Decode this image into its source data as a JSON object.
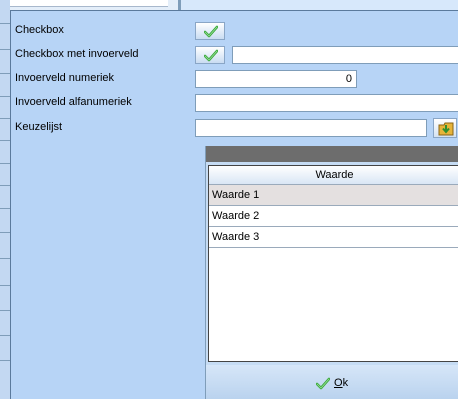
{
  "form": {
    "rows": [
      {
        "label": "Checkbox",
        "checked": true
      },
      {
        "label": "Checkbox met invoerveld",
        "checked": true,
        "value": ""
      },
      {
        "label": "Invoerveld numeriek",
        "value": "0"
      },
      {
        "label": "Invoerveld alfanumeriek",
        "value": ""
      },
      {
        "label": "Keuzelijst",
        "value": ""
      }
    ]
  },
  "picker": {
    "column_header": "Waarde",
    "items": [
      "Waarde 1",
      "Waarde 2",
      "Waarde 3"
    ],
    "selected_index": 0,
    "ok_label_underlined": "O",
    "ok_label_rest": "k"
  },
  "icons": {
    "check": "checkmark-icon",
    "picker": "folder-arrow-icon"
  },
  "colors": {
    "panel_background": "#b7d4f6",
    "check_green": "#3aa83a",
    "selected_row": "#e4e0e0"
  }
}
